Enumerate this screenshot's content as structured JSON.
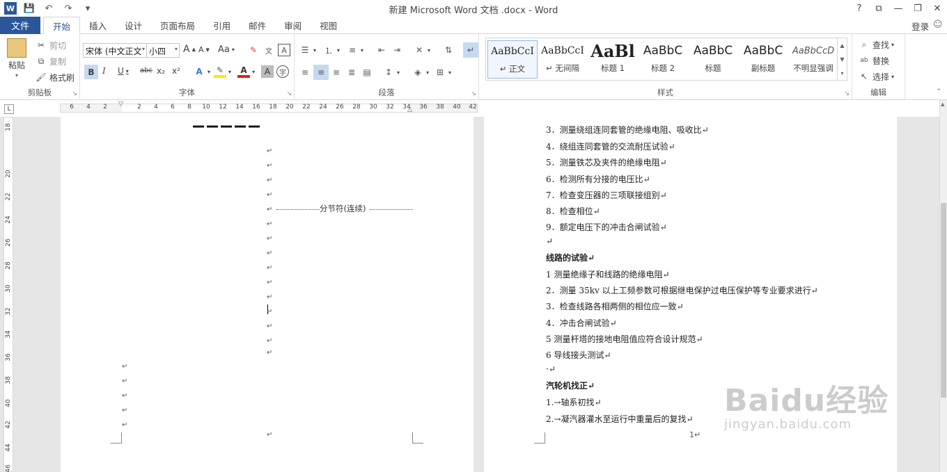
{
  "window": {
    "title": "新建 Microsoft Word 文档 .docx - Word",
    "controls": [
      "?",
      "⧉",
      "—",
      "❐",
      "✕"
    ]
  },
  "qat": {
    "save": "💾",
    "undo": "↶",
    "redo": "↷",
    "more": "▾"
  },
  "tabs": {
    "file": "文件",
    "items": [
      "开始",
      "插入",
      "设计",
      "页面布局",
      "引用",
      "邮件",
      "审阅",
      "视图"
    ],
    "active": "开始",
    "login": "登录"
  },
  "ribbon": {
    "clipboard": {
      "label": "剪贴板",
      "paste": "粘贴",
      "cut": "剪切",
      "copy": "复制",
      "format_painter": "格式刷"
    },
    "font": {
      "label": "字体",
      "font_name": "宋体 (中文正文",
      "font_size": "小四",
      "grow": "A",
      "shrink": "A",
      "case": "Aa",
      "bold": "B",
      "italic": "I",
      "underline": "U",
      "strike": "abc",
      "subscript": "x₂",
      "superscript": "x²"
    },
    "paragraph": {
      "label": "段落"
    },
    "styles": {
      "label": "样式",
      "items": [
        {
          "sample": "AaBbCcI",
          "name": "↵ 正文"
        },
        {
          "sample": "AaBbCcI",
          "name": "↵ 无间隔"
        },
        {
          "sample": "AaBl",
          "name": "标题 1"
        },
        {
          "sample": "AaBbC",
          "name": "标题 2"
        },
        {
          "sample": "AaBbC",
          "name": "标题"
        },
        {
          "sample": "AaBbC",
          "name": "副标题"
        },
        {
          "sample": "AaBbCcD",
          "name": "不明显强调"
        }
      ]
    },
    "editing": {
      "label": "编辑",
      "find": "查找",
      "replace": "替换",
      "select": "选择"
    }
  },
  "ruler": {
    "h_ticks": [
      "6",
      "4",
      "2",
      "2",
      "4",
      "6",
      "8",
      "10",
      "12",
      "14",
      "16",
      "18",
      "20",
      "22",
      "24",
      "26",
      "28",
      "30",
      "32",
      "34",
      "36",
      "38",
      "40",
      "42"
    ],
    "v_ticks": [
      "18",
      "20",
      "22",
      "24",
      "26",
      "28",
      "30",
      "32",
      "34",
      "36",
      "38",
      "40",
      "42",
      "44",
      "46"
    ]
  },
  "page1": {
    "section_break": "分节符(连续)",
    "para_mark": "↵"
  },
  "page2": {
    "lines": [
      "3．测量绕组连同套管的绝缘电阻、吸收比↵",
      "4．绕组连同套管的交流耐压试验↵",
      "5．测量铁芯及夹件的绝缘电阻↵",
      "6．检测所有分接的电压比↵",
      "7．检查变压器的三项联接组别↵",
      "8．检查相位↵",
      "9．额定电压下的冲击合闸试验↵",
      "↵",
      "线路的试验↵",
      "1  测量绝缘子和线路的绝缘电阻↵",
      "2．测量 35kv 以上工频参数可根据继电保护过电压保护等专业要求进行↵",
      "3．检查线路各相两侧的相位应一致↵",
      "4．冲击合闸试验↵",
      "5  测量杆塔的接地电阻值应符合设计规范↵",
      "6  导线接头测试↵",
      "·↵",
      "汽轮机找正↵",
      "1.→轴系初找↵",
      "2.→凝汽器灌水至运行中重量后的复找↵"
    ],
    "page_number": "1↵"
  },
  "watermark": {
    "brand": "Baidu经验",
    "url": "jingyan.baidu.com"
  }
}
